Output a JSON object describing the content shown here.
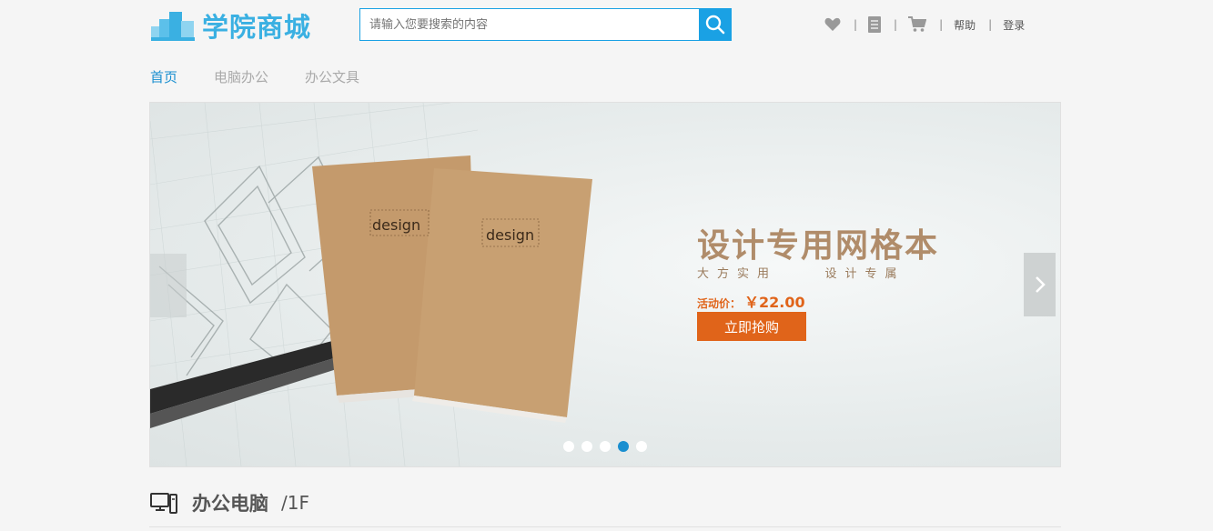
{
  "header": {
    "logo_text": "学院商城",
    "search_placeholder": "请输入您要搜索的内容",
    "toolbar": {
      "help": "帮助",
      "login": "登录",
      "separator": "|"
    }
  },
  "nav": {
    "items": [
      {
        "label": "首页",
        "active": true
      },
      {
        "label": "电脑办公",
        "active": false
      },
      {
        "label": "办公文具",
        "active": false
      }
    ]
  },
  "banner": {
    "headline": "设计专用网格本",
    "subline": "大方实用    设计专属",
    "price_label": "活动价：",
    "price_value": "￥22.00",
    "buy_label": "立即抢购",
    "notebook_brand": "design",
    "slide_count": 5,
    "active_slide": 4
  },
  "section": {
    "name": "办公电脑",
    "floor": "/1F"
  },
  "colors": {
    "accent": "#1aa1e4",
    "nav_active": "#1a8fd0",
    "buy_button": "#e0641a",
    "headline": "#b08c6a"
  },
  "icons": [
    "logo-buildings-icon",
    "search-icon",
    "heart-icon",
    "document-icon",
    "cart-icon",
    "chevron-right-icon",
    "computer-icon"
  ]
}
